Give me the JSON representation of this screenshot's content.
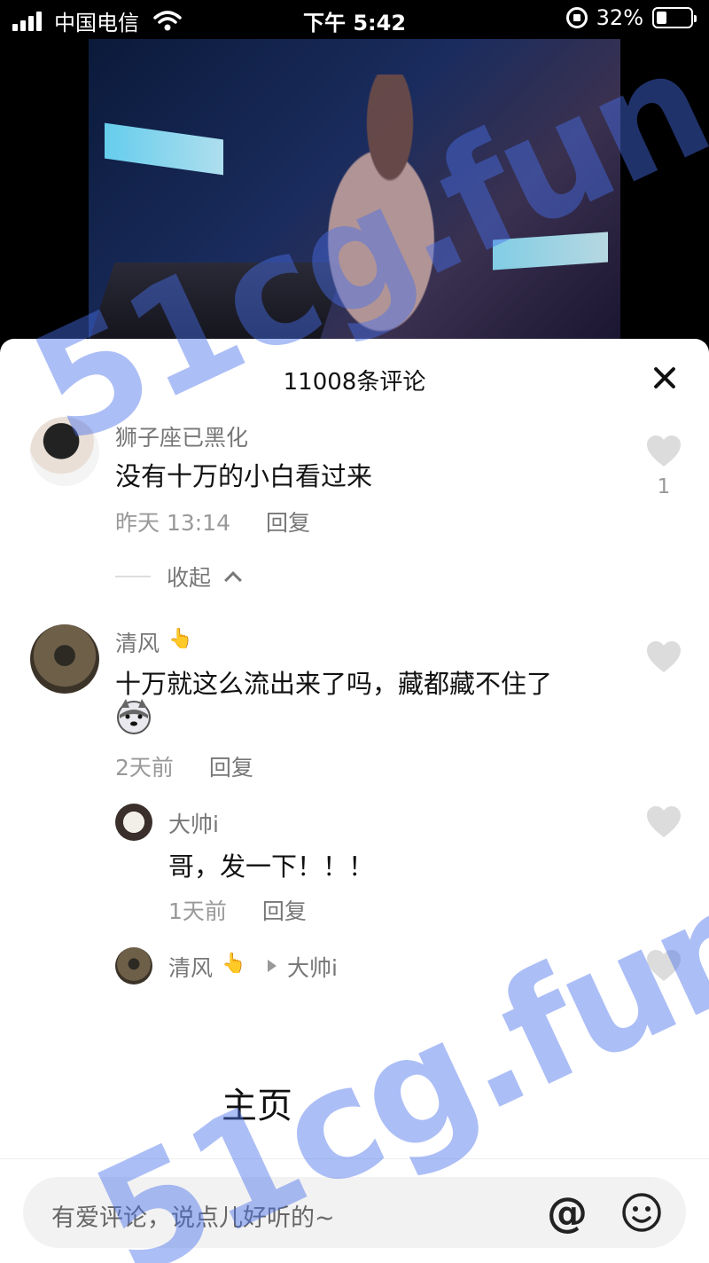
{
  "status_bar": {
    "carrier": "中国电信",
    "time": "下午 5:42",
    "battery": "32%"
  },
  "sheet": {
    "comment_count": "11008条评论",
    "collapse_label": "收起"
  },
  "comments": [
    {
      "username": "狮子座已黑化",
      "text": "没有十万的小白看过来",
      "time": "昨天 13:14",
      "reply_label": "回复",
      "likes": "1"
    },
    {
      "username": "清风",
      "text": "十万就这么流出来了吗，藏都藏不住了",
      "time": "2天前",
      "reply_label": "回复"
    }
  ],
  "replies": [
    {
      "username": "大帅i",
      "text": "哥，发一下！！！",
      "time": "1天前",
      "reply_label": "回复"
    },
    {
      "username": "清风",
      "reply_to": "大帅i"
    }
  ],
  "home_label": "主页",
  "input": {
    "placeholder": "有爱评论，说点儿好听的~",
    "at_symbol": "@"
  },
  "watermark": "51cg.fun",
  "icons": {
    "like": "heart-icon",
    "close": "close-icon",
    "emoji": "smiley-icon",
    "mention": "at-icon"
  },
  "colors": {
    "watermark": "#466eeb",
    "like_gray": "#dcdcdc"
  }
}
